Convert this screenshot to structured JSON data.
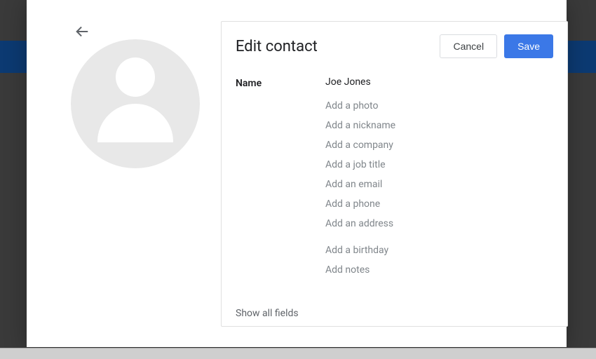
{
  "header": {
    "title": "Edit contact",
    "cancel_label": "Cancel",
    "save_label": "Save"
  },
  "form": {
    "name_label": "Name",
    "name_value": "Joe Jones",
    "add_items": {
      "photo": "Add a photo",
      "nickname": "Add a nickname",
      "company": "Add a company",
      "jobtitle": "Add a job title",
      "email": "Add an email",
      "phone": "Add a phone",
      "address": "Add an address",
      "birthday": "Add a birthday",
      "notes": "Add notes"
    },
    "show_all_label": "Show all fields"
  }
}
